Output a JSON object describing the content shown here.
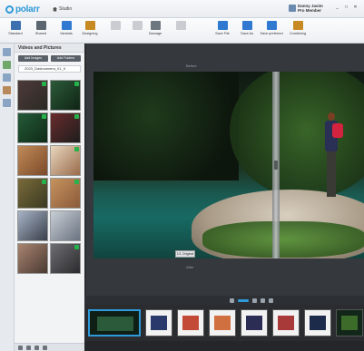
{
  "app": {
    "logo_text": "polarr",
    "home_label": "Studio"
  },
  "user": {
    "name": "Danny Jasim",
    "sub": "Pro Member"
  },
  "window_controls": [
    "_",
    "□",
    "✕"
  ],
  "toolbar": {
    "items": [
      {
        "label": "Standard",
        "icon": "standard-icon",
        "color": "#3b6fb0",
        "enabled": true
      },
      {
        "label": "Shared",
        "icon": "share-icon",
        "color": "#5c6670",
        "enabled": true
      },
      {
        "label": "Variants",
        "icon": "variants-icon",
        "color": "#2f7ad0",
        "enabled": true
      },
      {
        "label": "Designing",
        "icon": "design-icon",
        "color": "#c78a22",
        "enabled": true
      },
      {
        "label": "",
        "icon": "undo-icon",
        "color": "#c9cdd2",
        "enabled": false
      },
      {
        "label": "",
        "icon": "redo-icon",
        "color": "#c9cdd2",
        "enabled": false
      },
      {
        "label": "Damage",
        "icon": "damage-icon",
        "color": "#6d7780",
        "enabled": true
      },
      {
        "label": "",
        "icon": "blank-icon",
        "color": "#c9cdd2",
        "enabled": false
      },
      {
        "label": "Save File",
        "icon": "save-file-icon",
        "color": "#2f7ad0",
        "enabled": true
      },
      {
        "label": "Save As",
        "icon": "save-as-icon",
        "color": "#2f7ad0",
        "enabled": true
      },
      {
        "label": "Save preferred",
        "icon": "save-pref-icon",
        "color": "#2f7ad0",
        "enabled": true
      },
      {
        "label": "Combining",
        "icon": "combine-icon",
        "color": "#c78a22",
        "enabled": true
      }
    ]
  },
  "left_panel": {
    "title": "Videos and Pictures",
    "btn1": "Add Images",
    "btn2": "Add Folders",
    "folder": "2023_Dashcamera_01_II",
    "thumbs": [
      {
        "c1": "#4d3a3a",
        "c2": "#2b2a24",
        "checked": true
      },
      {
        "c1": "#2c5a3a",
        "c2": "#0f2414",
        "checked": true
      },
      {
        "c1": "#245a38",
        "c2": "#0f2a16",
        "checked": true
      },
      {
        "c1": "#6a2c2c",
        "c2": "#1d1d1d",
        "checked": true
      },
      {
        "c1": "#c18b58",
        "c2": "#7a4a2a",
        "checked": false
      },
      {
        "c1": "#e8d7bf",
        "c2": "#9a6b4b",
        "checked": true
      },
      {
        "c1": "#7a6a3a",
        "c2": "#3a3a22",
        "checked": true
      },
      {
        "c1": "#c6935e",
        "c2": "#8a5a3a",
        "checked": true
      },
      {
        "c1": "#a7b4c8",
        "c2": "#3a3f4a",
        "checked": false
      },
      {
        "c1": "#c9cfd6",
        "c2": "#6a7380",
        "checked": false
      },
      {
        "c1": "#a88470",
        "c2": "#4a3a32",
        "checked": false
      },
      {
        "c1": "#6e6d71",
        "c2": "#2b2b2e",
        "checked": true
      }
    ]
  },
  "editor": {
    "top_label": "Before",
    "bottom_label": "After",
    "badge": "1/1 Original"
  },
  "filmstrip": {
    "frames": [
      {
        "bg": "#0f1f16",
        "inner": "#2a5a3a",
        "selected": true
      },
      {
        "bg": "#f2f2f2",
        "inner": "#2a3a6a",
        "selected": false
      },
      {
        "bg": "#f2f2f2",
        "inner": "#c24a36",
        "selected": false
      },
      {
        "bg": "#f2f2f2",
        "inner": "#d07040",
        "selected": false
      },
      {
        "bg": "#f2f2f2",
        "inner": "#2b2d55",
        "selected": false
      },
      {
        "bg": "#f2f2f2",
        "inner": "#a83a3a",
        "selected": false
      },
      {
        "bg": "#f2f2f2",
        "inner": "#1c2b4a",
        "selected": false
      },
      {
        "bg": "#12261a",
        "inner": "#3d6b2a",
        "selected": false
      },
      {
        "bg": "#f2f2f2",
        "inner": "#6a2a2a",
        "selected": false
      }
    ]
  }
}
